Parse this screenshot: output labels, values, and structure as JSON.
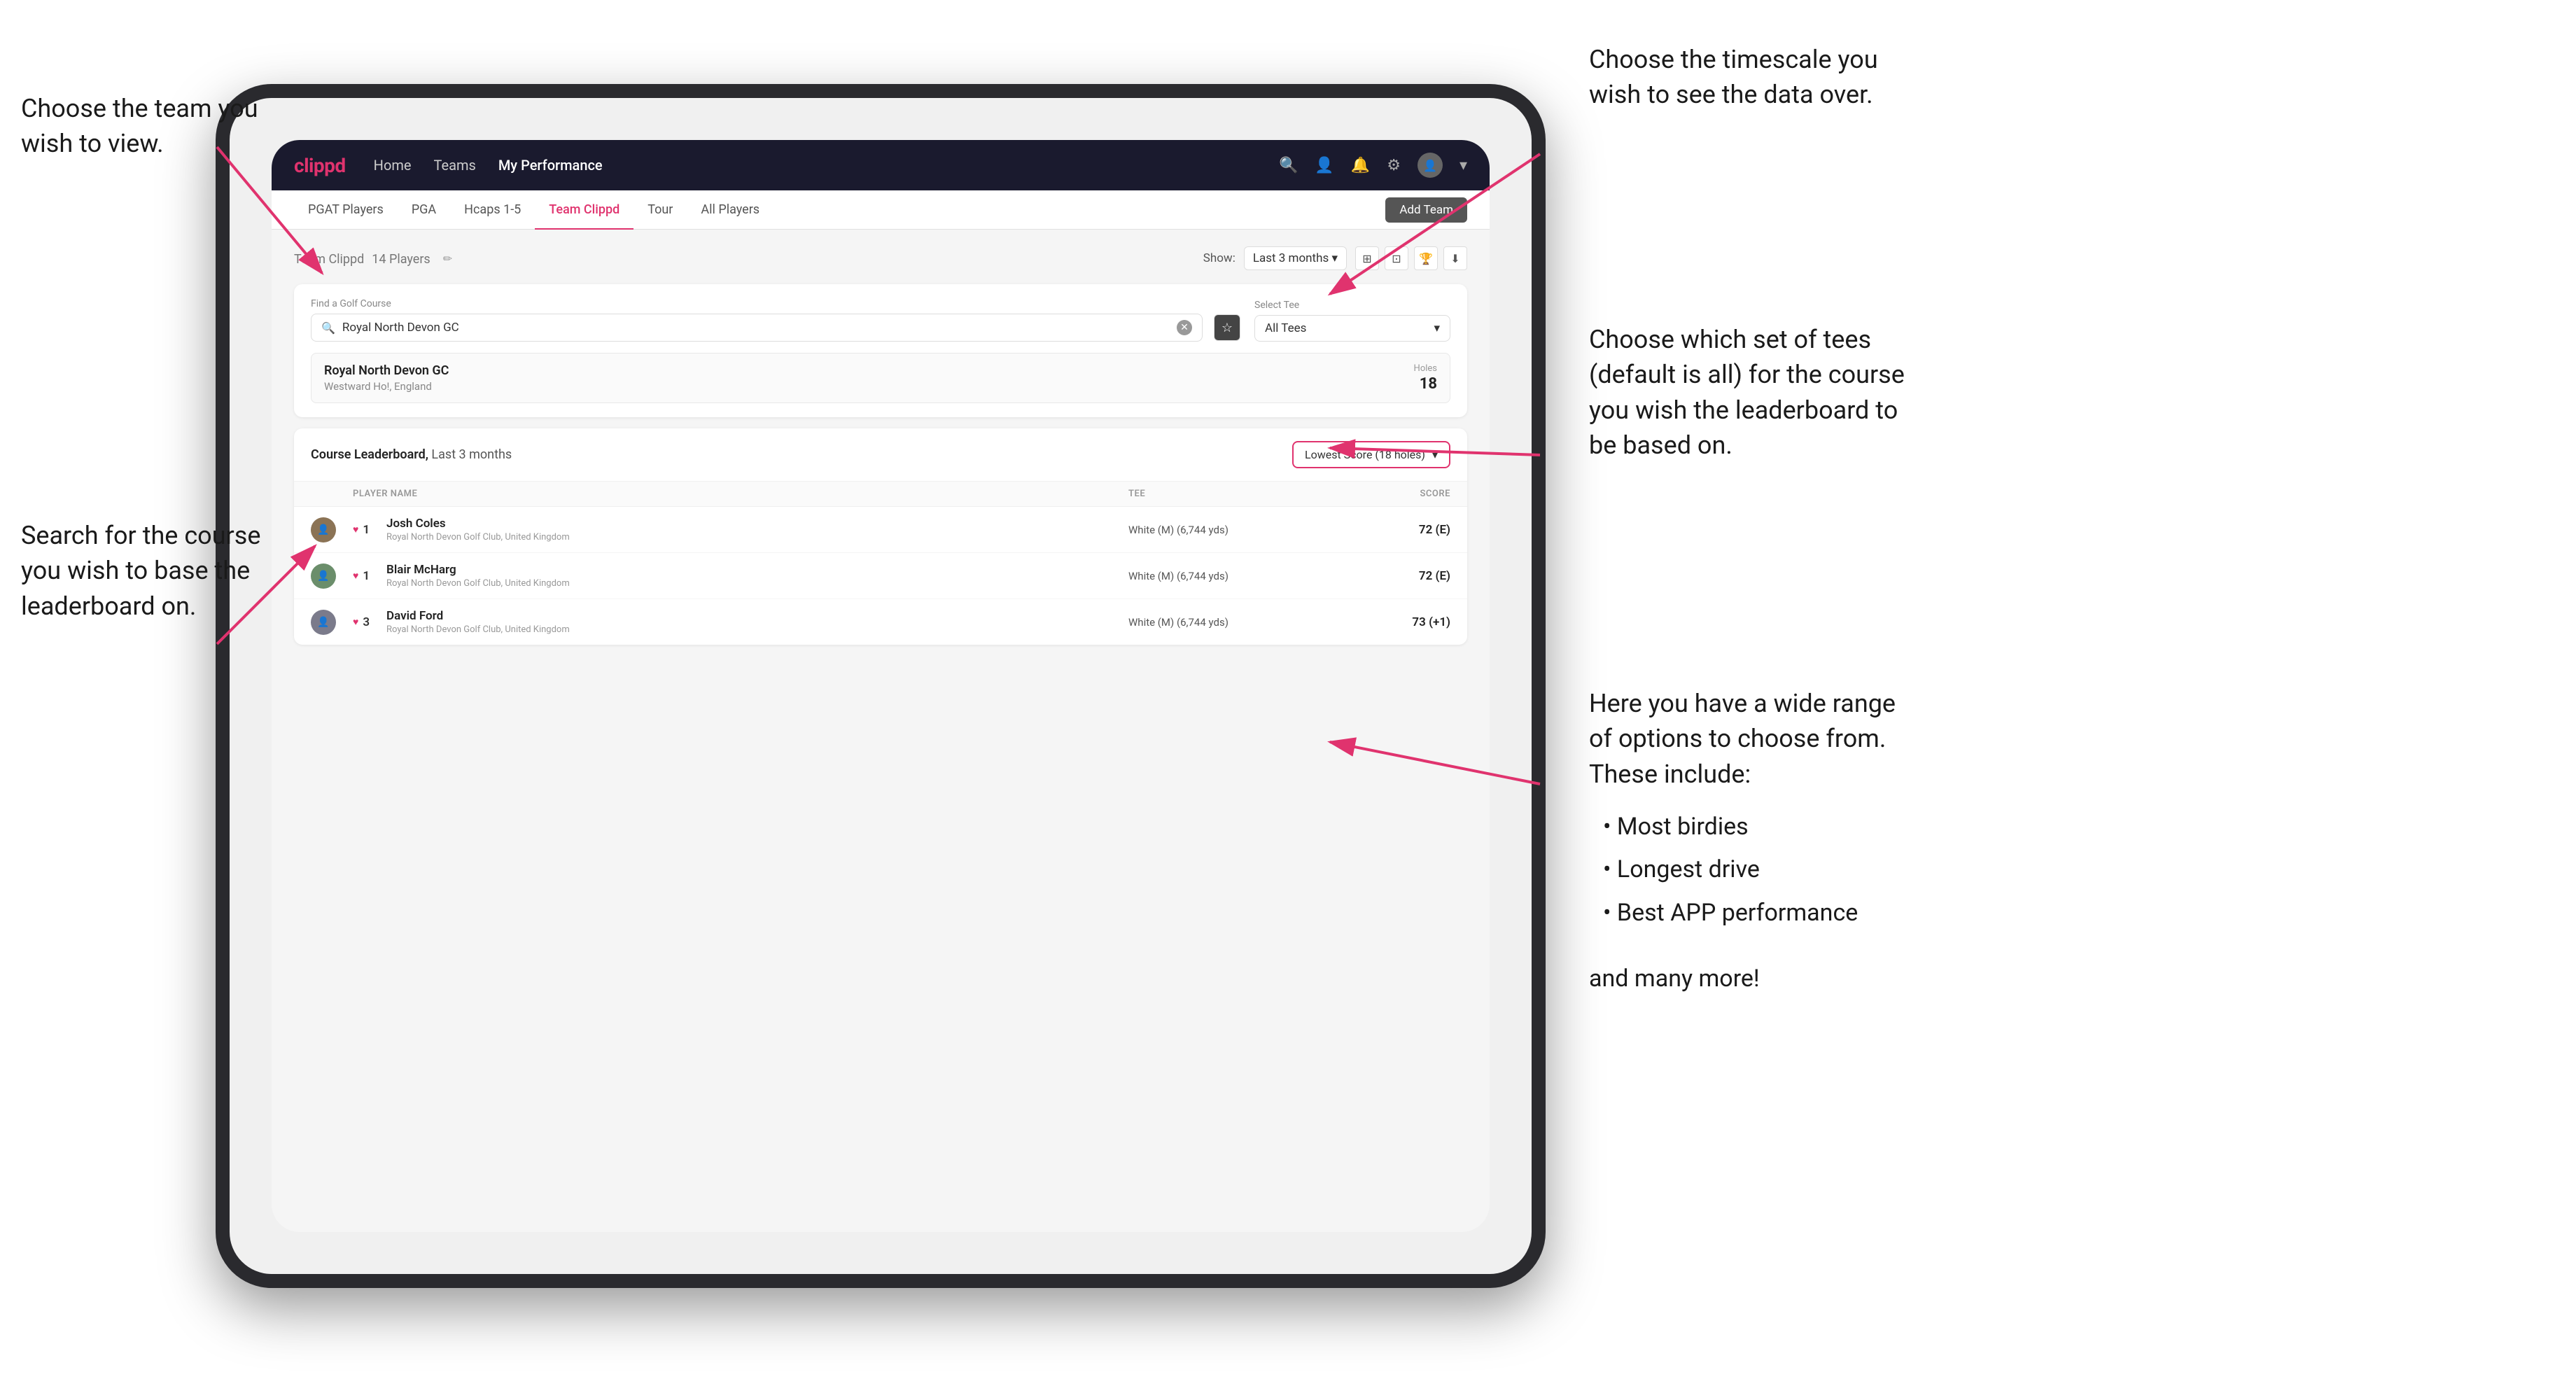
{
  "annotations": {
    "top_left_title": "Choose the team you\nwish to view.",
    "mid_left_title": "Search for the course\nyou wish to base the\nleaderboard on.",
    "top_right_title": "Choose the timescale you\nwish to see the data over.",
    "mid_right_title": "Choose which set of tees\n(default is all) for the course\nyou wish the leaderboard to\nbe based on.",
    "bottom_right_title": "Here you have a wide range\nof options to choose from.\nThese include:",
    "bullets": [
      "Most birdies",
      "Longest drive",
      "Best APP performance"
    ],
    "bottom_right_extra": "and many more!"
  },
  "navbar": {
    "brand": "clippd",
    "links": [
      "Home",
      "Teams",
      "My Performance"
    ],
    "active_link": "My Performance",
    "icons": [
      "search",
      "person",
      "bell",
      "settings",
      "account"
    ]
  },
  "tabs": {
    "items": [
      "PGAT Players",
      "PGA",
      "Hcaps 1-5",
      "Team Clippd",
      "Tour",
      "All Players"
    ],
    "active": "Team Clippd",
    "add_team_label": "Add Team"
  },
  "team_header": {
    "title": "Team Clippd",
    "player_count": "14 Players",
    "show_label": "Show:",
    "show_value": "Last 3 months",
    "view_modes": [
      "grid-small",
      "grid-large",
      "trophy",
      "download"
    ]
  },
  "course_search": {
    "find_label": "Find a Golf Course",
    "search_placeholder": "Royal North Devon GC",
    "select_tee_label": "Select Tee",
    "tee_value": "All Tees"
  },
  "course_result": {
    "name": "Royal North Devon GC",
    "location": "Westward Ho!, England",
    "holes_label": "Holes",
    "holes_count": "18"
  },
  "leaderboard": {
    "title": "Course Leaderboard,",
    "title_period": "Last 3 months",
    "score_type": "Lowest Score (18 holes)",
    "columns": {
      "player": "PLAYER NAME",
      "tee": "TEE",
      "score": "SCORE"
    },
    "players": [
      {
        "rank": "1",
        "name": "Josh Coles",
        "club": "Royal North Devon Golf Club, United Kingdom",
        "tee": "White (M) (6,744 yds)",
        "score": "72 (E)",
        "avatar_color": "#8B7355"
      },
      {
        "rank": "1",
        "name": "Blair McHarg",
        "club": "Royal North Devon Golf Club, United Kingdom",
        "tee": "White (M) (6,744 yds)",
        "score": "72 (E)",
        "avatar_color": "#6B8E6B"
      },
      {
        "rank": "3",
        "name": "David Ford",
        "club": "Royal North Devon Golf Club, United Kingdom",
        "tee": "White (M) (6,744 yds)",
        "score": "73 (+1)",
        "avatar_color": "#7B7B8B"
      }
    ]
  }
}
